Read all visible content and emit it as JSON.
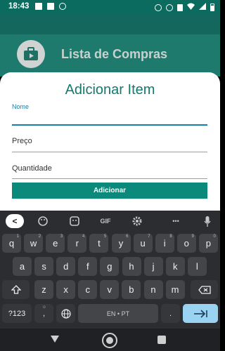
{
  "status_bar": {
    "time": "18:43",
    "icons_left": [
      "mail-icon",
      "image-icon",
      "whatsapp-icon"
    ],
    "icons_right": [
      "alarm-icon",
      "headset-icon",
      "vibrate-icon",
      "wifi-icon",
      "signal-icon",
      "battery-icon"
    ]
  },
  "app": {
    "title": "Lista de Compras",
    "icon": "shopping-bag-icon"
  },
  "dialog": {
    "title": "Adicionar Item",
    "fields": {
      "nome": {
        "label": "Nome",
        "value": ""
      },
      "preco": {
        "label": "Preço",
        "value": ""
      },
      "quantidade": {
        "label": "Quantidade",
        "value": ""
      }
    },
    "button_label": "Adicionar"
  },
  "keyboard": {
    "toolbar": {
      "back": "<",
      "gif": "GIF",
      "more": "•••"
    },
    "row1": [
      {
        "k": "q",
        "h": "1"
      },
      {
        "k": "w",
        "h": "2"
      },
      {
        "k": "e",
        "h": "3"
      },
      {
        "k": "r",
        "h": "4"
      },
      {
        "k": "t",
        "h": "5"
      },
      {
        "k": "y",
        "h": "6"
      },
      {
        "k": "u",
        "h": "7"
      },
      {
        "k": "i",
        "h": "8"
      },
      {
        "k": "o",
        "h": "9"
      },
      {
        "k": "p",
        "h": "0"
      }
    ],
    "row2": [
      "a",
      "s",
      "d",
      "f",
      "g",
      "h",
      "j",
      "k",
      "l"
    ],
    "row3": [
      "z",
      "x",
      "c",
      "v",
      "b",
      "n",
      "m"
    ],
    "symbols": "?123",
    "comma": ",",
    "space_label": "EN • PT",
    "period": "."
  },
  "colors": {
    "accent": "#0b8a7b",
    "title_teal": "#127a6d",
    "keyboard_bg": "#2b2d30",
    "key_bg": "#434548",
    "enter_key": "#9ad3f2"
  }
}
